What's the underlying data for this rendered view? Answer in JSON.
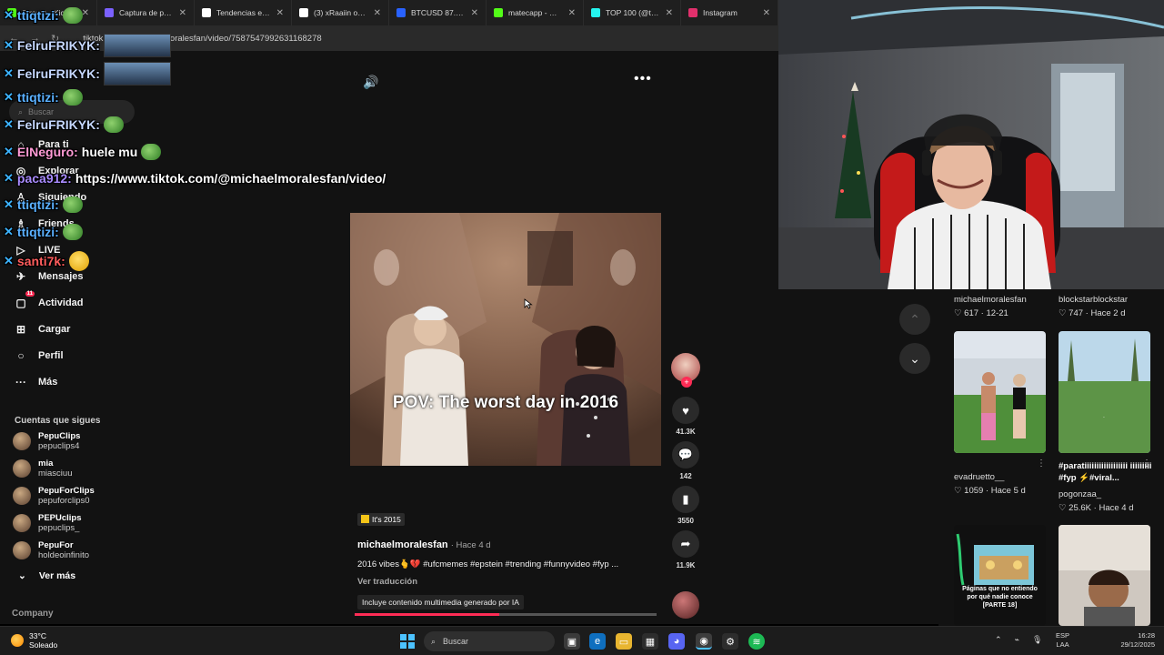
{
  "browser": {
    "tabs": [
      {
        "title": "Stream - Kick Dash",
        "color": "#53fc18"
      },
      {
        "title": "Captura de pantalla",
        "color": "#7b61ff"
      },
      {
        "title": "Tendencias en Arg",
        "color": "#ffffff"
      },
      {
        "title": "(3) xRaaiin on X",
        "color": "#ffffff"
      },
      {
        "title": "BTCUSD 87.441,26",
        "color": "#2962ff"
      },
      {
        "title": "matecapp - Watch",
        "color": "#53fc18"
      },
      {
        "title": "TOP 100 (@top10",
        "color": "#25f4ee"
      },
      {
        "title": "Instagram",
        "color": "#e1306c"
      }
    ],
    "url": "tiktok.com/@michaelmoralesfan/video/7587547992631168278"
  },
  "sidebar": {
    "search_placeholder": "Buscar",
    "items": [
      {
        "label": "Para ti",
        "icon": "home-icon"
      },
      {
        "label": "Explorar",
        "icon": "compass-icon"
      },
      {
        "label": "Siguiendo",
        "icon": "following-icon"
      },
      {
        "label": "Friends",
        "icon": "friends-icon"
      },
      {
        "label": "LIVE",
        "icon": "live-icon"
      },
      {
        "label": "Mensajes",
        "icon": "messages-icon"
      },
      {
        "label": "Actividad",
        "icon": "activity-icon",
        "badge": "11"
      },
      {
        "label": "Cargar",
        "icon": "upload-icon"
      },
      {
        "label": "Perfil",
        "icon": "profile-icon"
      },
      {
        "label": "Más",
        "icon": "more-icon"
      }
    ],
    "following_title": "Cuentas que sigues",
    "following": [
      {
        "name": "PepuClips",
        "handle": "pepuclips4"
      },
      {
        "name": "mia",
        "handle": "miasciuu"
      },
      {
        "name": "PepuForClips",
        "handle": "pepuforclips0"
      },
      {
        "name": "PEPUclips",
        "handle": "pepuclips_"
      },
      {
        "name": "PepuFor",
        "handle": "holdeoinfinito"
      }
    ],
    "see_more": "Ver más",
    "company": "Company"
  },
  "video": {
    "caption": "POV: The worst day in 2016",
    "progress": 0.48,
    "likes": "41.3K",
    "comments": "142",
    "saves": "3550",
    "shares": "11.9K",
    "tag": "It's 2015",
    "author": "michaelmoralesfan",
    "time": "· Hace 4 d",
    "description": "2016 vibes🫰💔 #ufcmemes #epstein #trending #funnyvideo #fyp ...",
    "translate": "Ver traducción",
    "ai_note": "Incluye contenido multimedia generado por IA"
  },
  "related": [
    {
      "user": "michaelmoralesfan",
      "likes": "617",
      "date": "12-21"
    },
    {
      "user": "blockstarblockstar",
      "likes": "747",
      "date": "Hace 2 d"
    },
    {
      "user": "evadruetto__",
      "likes": "1059",
      "date": "Hace 5 d",
      "title": ""
    },
    {
      "user": "pogonzaa_",
      "likes": "25.6K",
      "date": "Hace 4 d",
      "title": "#paratiiiiiiiiiiiiiiiiii iiiiiiiii #fyp ⚡#viral..."
    },
    {
      "thumb_text": "Páginas que no entiendo por qué nadie conoce [PARTE 18]"
    }
  ],
  "chat": [
    {
      "name": "ttiqtizi:",
      "color": "#5ab0ff",
      "msg": "",
      "emote": "pepe"
    },
    {
      "name": "FelruFRIKYK:",
      "color": "#c6d8ff",
      "msg": "",
      "emote": "img"
    },
    {
      "name": "FelruFRIKYK:",
      "color": "#c6d8ff",
      "msg": "",
      "emote": "img"
    },
    {
      "name": "ttiqtizi:",
      "color": "#5ab0ff",
      "msg": "",
      "emote": "pepe"
    },
    {
      "name": "FelruFRIKYK:",
      "color": "#c6d8ff",
      "msg": "",
      "emote": "pepe"
    },
    {
      "name": "ElNeguro:",
      "color": "#ff9bd6",
      "msg": "huele mu",
      "emote": "pepe"
    },
    {
      "name": "paca912:",
      "color": "#a98bff",
      "msg": "https://www.tiktok.com/@michaelmoralesfan/video/",
      "emote": ""
    },
    {
      "name": "ttiqtizi:",
      "color": "#5ab0ff",
      "msg": "",
      "emote": "pepe"
    },
    {
      "name": "ttiqtizi:",
      "color": "#5ab0ff",
      "msg": "",
      "emote": "pepe"
    },
    {
      "name": "santi7k:",
      "color": "#ff5d5d",
      "msg": "",
      "emote": "face"
    }
  ],
  "taskbar": {
    "temp": "33°C",
    "weather": "Soleado",
    "search": "Buscar",
    "lang1": "ESP",
    "lang2": "LAA",
    "time": "16:28",
    "date": "29/12/2025"
  }
}
